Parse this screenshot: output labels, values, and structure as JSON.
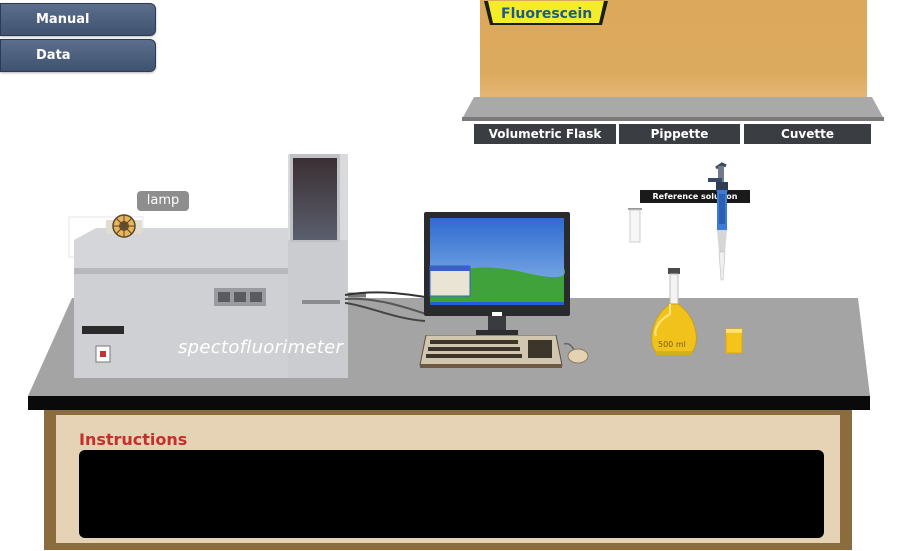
{
  "nav": {
    "manual_label": "Manual",
    "data_label": "Data"
  },
  "shelf": {
    "sample_tab": "Fluorescein",
    "buttons": [
      "Volumetric Flask",
      "Pippette",
      "Cuvette"
    ]
  },
  "lab": {
    "lamp_label": "lamp",
    "instrument_label": "spectofluorimeter",
    "reference_label": "Reference solution",
    "flask_label": "500 ml"
  },
  "instructions": {
    "title": "Instructions",
    "text": ""
  },
  "colors": {
    "nav_button": "#4a5d7a",
    "shelf_panel": "#dca95c",
    "bench_top": "#a6a6a6",
    "cabinet_frame": "#8a6c3e",
    "cabinet_panel": "#e6d2b4",
    "instructions_title": "#c4302b",
    "fluorescein": "#f5c518"
  }
}
